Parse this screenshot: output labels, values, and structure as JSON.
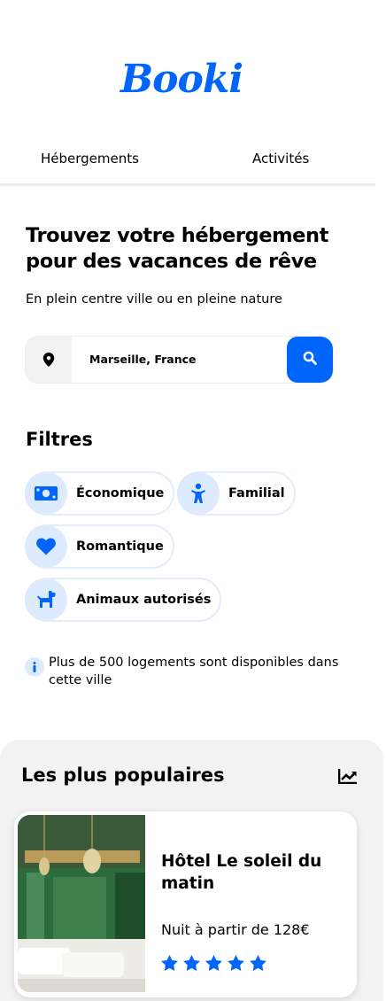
{
  "brand": {
    "name": "Booki",
    "color": "#0065FC"
  },
  "nav": {
    "items": [
      {
        "label": "Hébergements"
      },
      {
        "label": "Activités"
      }
    ]
  },
  "hero": {
    "title": "Trouvez votre hébergement pour des vacances de rêve",
    "subtitle": "En plein centre ville ou en pleine nature"
  },
  "search": {
    "value": "Marseille, France",
    "pin_icon": "location-pin-icon",
    "button_icon": "search-icon"
  },
  "filters": {
    "title": "Filtres",
    "items": [
      {
        "label": "Économique",
        "icon": "money-icon"
      },
      {
        "label": "Familial",
        "icon": "child-icon"
      },
      {
        "label": "Romantique",
        "icon": "heart-icon"
      },
      {
        "label": "Animaux autorisés",
        "icon": "dog-icon"
      }
    ]
  },
  "info": {
    "text": "Plus de 500 logements sont disponibles dans cette ville",
    "icon": "info-icon"
  },
  "popular": {
    "title": "Les plus populaires",
    "icon": "trend-up-icon",
    "cards": [
      {
        "name": "Hôtel Le soleil du matin",
        "price": "Nuit à partir de 128€",
        "rating": 5,
        "rating_max": 5
      }
    ]
  },
  "colors": {
    "accent": "#0065FC",
    "chip_bg": "#DEEBFF",
    "section_bg": "#F2F2F2"
  }
}
